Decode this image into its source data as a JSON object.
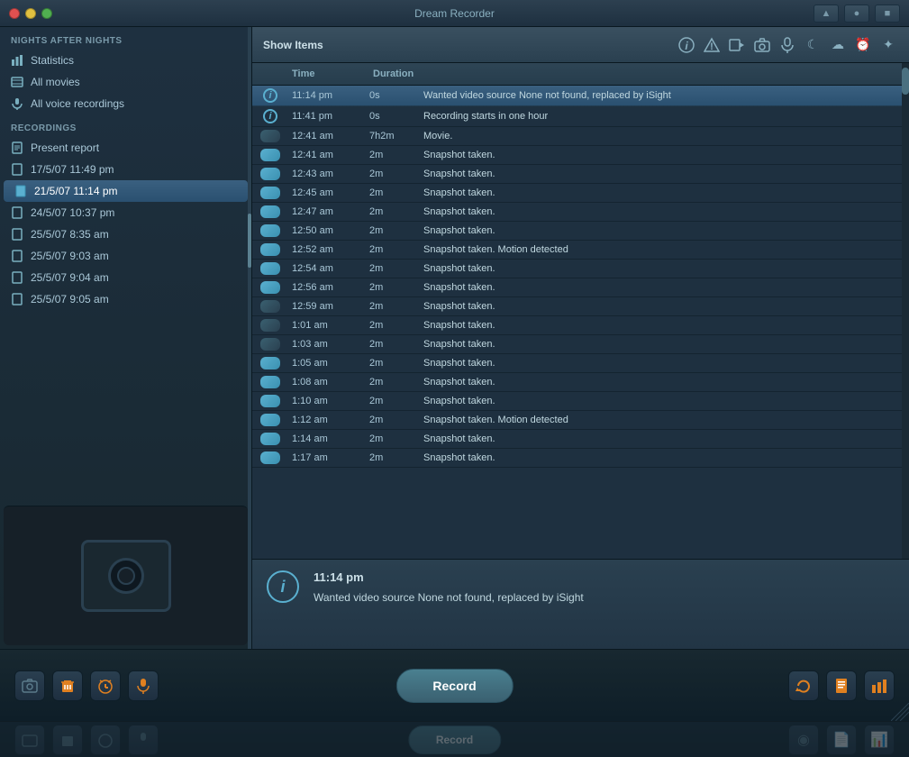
{
  "app": {
    "title": "Dream Recorder",
    "title_bar_buttons": [
      "red",
      "yellow",
      "green"
    ],
    "title_bar_actions": [
      "▲",
      "●",
      "■"
    ]
  },
  "sidebar": {
    "top_section_title": "NIGHTS AFTER NIGHTS",
    "nav_items": [
      {
        "id": "statistics",
        "label": "Statistics",
        "icon": "bar-chart"
      },
      {
        "id": "movies",
        "label": "All movies",
        "icon": "film"
      },
      {
        "id": "voice",
        "label": "All voice recordings",
        "icon": "mic"
      }
    ],
    "recordings_section_title": "RECORDINGS",
    "recording_items": [
      {
        "id": "present",
        "label": "Present report",
        "icon": "doc"
      },
      {
        "id": "r1",
        "label": "17/5/07 11:49 pm",
        "icon": "doc"
      },
      {
        "id": "r2",
        "label": "21/5/07 11:14 pm",
        "icon": "doc",
        "active": true
      },
      {
        "id": "r3",
        "label": "24/5/07 10:37 pm",
        "icon": "doc"
      },
      {
        "id": "r4",
        "label": "25/5/07 8:35 am",
        "icon": "doc"
      },
      {
        "id": "r5",
        "label": "25/5/07 9:03 am",
        "icon": "doc"
      },
      {
        "id": "r6",
        "label": "25/5/07 9:04 am",
        "icon": "doc"
      },
      {
        "id": "r7",
        "label": "25/5/07 9:05 am",
        "icon": "doc"
      }
    ]
  },
  "content": {
    "show_items_label": "Show Items",
    "filter_icons": [
      "ℹ",
      "⚠",
      "▐",
      "📷",
      "🎤",
      "☾",
      "☁",
      "⏰",
      "✦"
    ],
    "table_headers": {
      "time": "Time",
      "duration": "Duration",
      "description": ""
    },
    "rows": [
      {
        "id": 1,
        "icon_type": "info",
        "time": "11:14 pm",
        "duration": "0s",
        "desc": "Wanted video source None not found, replaced by iSight",
        "selected": true
      },
      {
        "id": 2,
        "icon_type": "info",
        "time": "11:41 pm",
        "duration": "0s",
        "desc": "Recording starts in one hour",
        "selected": false
      },
      {
        "id": 3,
        "icon_type": "camera-dark",
        "time": "12:41 am",
        "duration": "7h2m",
        "desc": "Movie.",
        "selected": false
      },
      {
        "id": 4,
        "icon_type": "camera-blue",
        "time": "12:41 am",
        "duration": "2m",
        "desc": "Snapshot taken.",
        "selected": false
      },
      {
        "id": 5,
        "icon_type": "camera-blue",
        "time": "12:43 am",
        "duration": "2m",
        "desc": "Snapshot taken.",
        "selected": false
      },
      {
        "id": 6,
        "icon_type": "camera-blue",
        "time": "12:45 am",
        "duration": "2m",
        "desc": "Snapshot taken.",
        "selected": false
      },
      {
        "id": 7,
        "icon_type": "camera-blue",
        "time": "12:47 am",
        "duration": "2m",
        "desc": "Snapshot taken.",
        "selected": false
      },
      {
        "id": 8,
        "icon_type": "camera-blue",
        "time": "12:50 am",
        "duration": "2m",
        "desc": "Snapshot taken.",
        "selected": false
      },
      {
        "id": 9,
        "icon_type": "camera-blue",
        "time": "12:52 am",
        "duration": "2m",
        "desc": "Snapshot taken. Motion detected",
        "selected": false
      },
      {
        "id": 10,
        "icon_type": "camera-blue",
        "time": "12:54 am",
        "duration": "2m",
        "desc": "Snapshot taken.",
        "selected": false
      },
      {
        "id": 11,
        "icon_type": "camera-blue",
        "time": "12:56 am",
        "duration": "2m",
        "desc": "Snapshot taken.",
        "selected": false
      },
      {
        "id": 12,
        "icon_type": "camera-dark",
        "time": "12:59 am",
        "duration": "2m",
        "desc": "Snapshot taken.",
        "selected": false
      },
      {
        "id": 13,
        "icon_type": "camera-dark",
        "time": "1:01 am",
        "duration": "2m",
        "desc": "Snapshot taken.",
        "selected": false
      },
      {
        "id": 14,
        "icon_type": "camera-dark",
        "time": "1:03 am",
        "duration": "2m",
        "desc": "Snapshot taken.",
        "selected": false
      },
      {
        "id": 15,
        "icon_type": "camera-blue",
        "time": "1:05 am",
        "duration": "2m",
        "desc": "Snapshot taken.",
        "selected": false
      },
      {
        "id": 16,
        "icon_type": "camera-blue",
        "time": "1:08 am",
        "duration": "2m",
        "desc": "Snapshot taken.",
        "selected": false
      },
      {
        "id": 17,
        "icon_type": "camera-blue",
        "time": "1:10 am",
        "duration": "2m",
        "desc": "Snapshot taken.",
        "selected": false
      },
      {
        "id": 18,
        "icon_type": "camera-blue",
        "time": "1:12 am",
        "duration": "2m",
        "desc": "Snapshot taken. Motion detected",
        "selected": false
      },
      {
        "id": 19,
        "icon_type": "camera-blue",
        "time": "1:14 am",
        "duration": "2m",
        "desc": "Snapshot taken.",
        "selected": false
      },
      {
        "id": 20,
        "icon_type": "camera-blue",
        "time": "1:17 am",
        "duration": "2m",
        "desc": "Snapshot taken.",
        "selected": false
      }
    ],
    "detail": {
      "time": "11:14 pm",
      "message": "Wanted video source None not found, replaced by iSight"
    }
  },
  "toolbar": {
    "record_label": "Record",
    "left_buttons": [
      "📷",
      "🗑",
      "⏰",
      "🎤"
    ],
    "right_buttons": [
      "↺",
      "📄",
      "📊"
    ]
  }
}
